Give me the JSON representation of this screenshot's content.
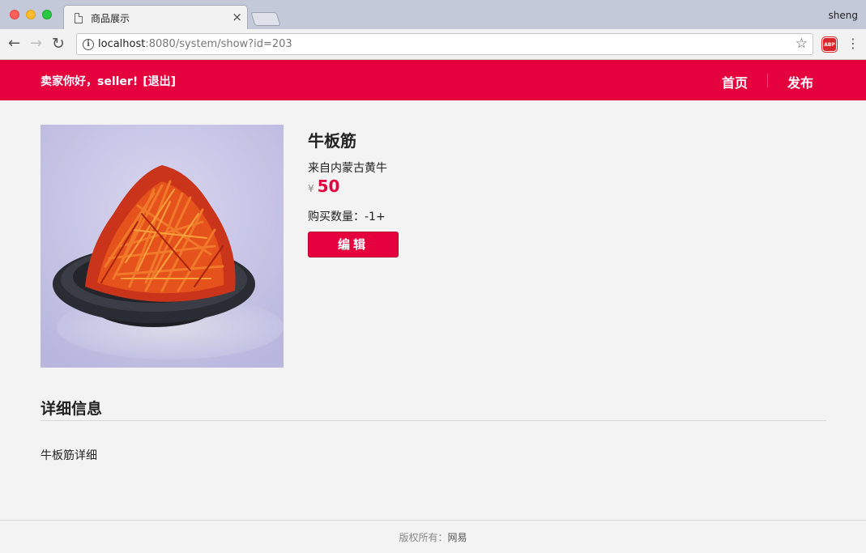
{
  "browser": {
    "tab_title": "商品展示",
    "tab_close": "×",
    "profile": "sheng",
    "url_host": "localhost",
    "url_rest": ":8080/system/show?id=203",
    "back_glyph": "←",
    "forward_glyph": "→",
    "reload_glyph": "↻",
    "info_glyph": "i",
    "star_glyph": "☆",
    "adblock_label": "ABP",
    "menu_glyph": "⋮"
  },
  "header": {
    "welcome_prefix": "卖家你好，",
    "username": "seller!",
    "logout_label": "[退出]",
    "nav_home": "首页",
    "nav_publish": "发布",
    "accent_color": "#e5003e"
  },
  "product": {
    "title": "牛板筋",
    "summary": "来自内蒙古黄牛",
    "currency": "¥",
    "price": "50",
    "quantity_label": "购买数量：",
    "quantity_value": "-1+",
    "edit_label": "编辑",
    "image_alt": "spicy beef tendon on black plate"
  },
  "detail": {
    "heading": "详细信息",
    "text": "牛板筋详细"
  },
  "footer": {
    "copyright_label": "版权所有：",
    "brand": "网易"
  }
}
